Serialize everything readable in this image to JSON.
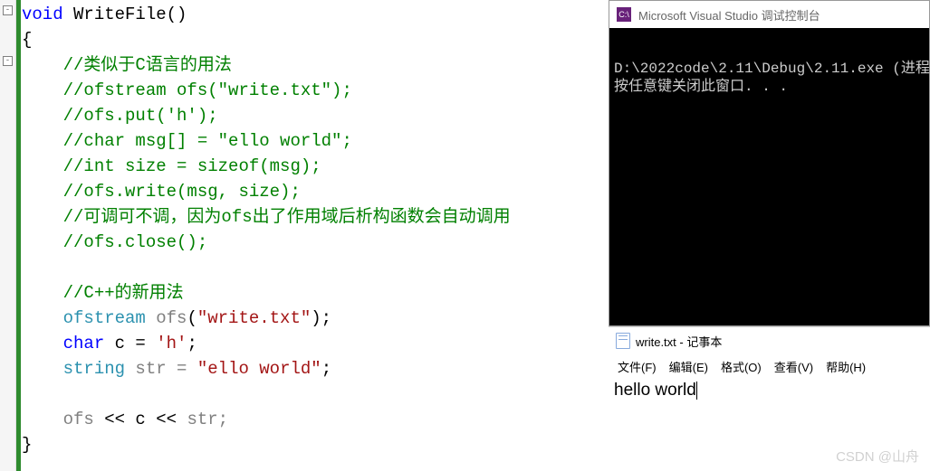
{
  "editor": {
    "fn_keyword": "void",
    "fn_name": "WriteFile",
    "fn_params": "()",
    "brace_open": "{",
    "brace_close": "}",
    "comments": {
      "c1": "//类似于C语言的用法",
      "c2": "//ofstream ofs(\"write.txt\");",
      "c3": "//ofs.put('h');",
      "c4": "//char msg[] = \"ello world\";",
      "c5": "//int size = sizeof(msg);",
      "c6": "//ofs.write(msg, size);",
      "c7": "//可调可不调，因为ofs出了作用域后析构函数会自动调用",
      "c8": "//ofs.close();",
      "c9": "//C++的新用法"
    },
    "line_ofs": {
      "type": "ofstream",
      "var": " ofs",
      "open": "(",
      "str": "\"write.txt\"",
      "close": ");"
    },
    "line_char": {
      "kw": "char",
      "var": " c = ",
      "str": "'h'",
      "end": ";"
    },
    "line_str": {
      "type": "string",
      "var": " str = ",
      "str": "\"ello world\"",
      "end": ";"
    },
    "line_out": {
      "a": "ofs ",
      "op1": "<<",
      "b": " c ",
      "op2": "<<",
      "c": " str;"
    }
  },
  "console": {
    "icon_text": "C:\\",
    "title": "Microsoft Visual Studio 调试控制台",
    "line1": "D:\\2022code\\2.11\\Debug\\2.11.exe (进程",
    "line2": "按任意键关闭此窗口. . ."
  },
  "notepad": {
    "title": "write.txt - 记事本",
    "menu": {
      "file": "文件(F)",
      "edit": "编辑(E)",
      "format": "格式(O)",
      "view": "查看(V)",
      "help": "帮助(H)"
    },
    "content": "hello world"
  },
  "watermark": "CSDN @山舟"
}
